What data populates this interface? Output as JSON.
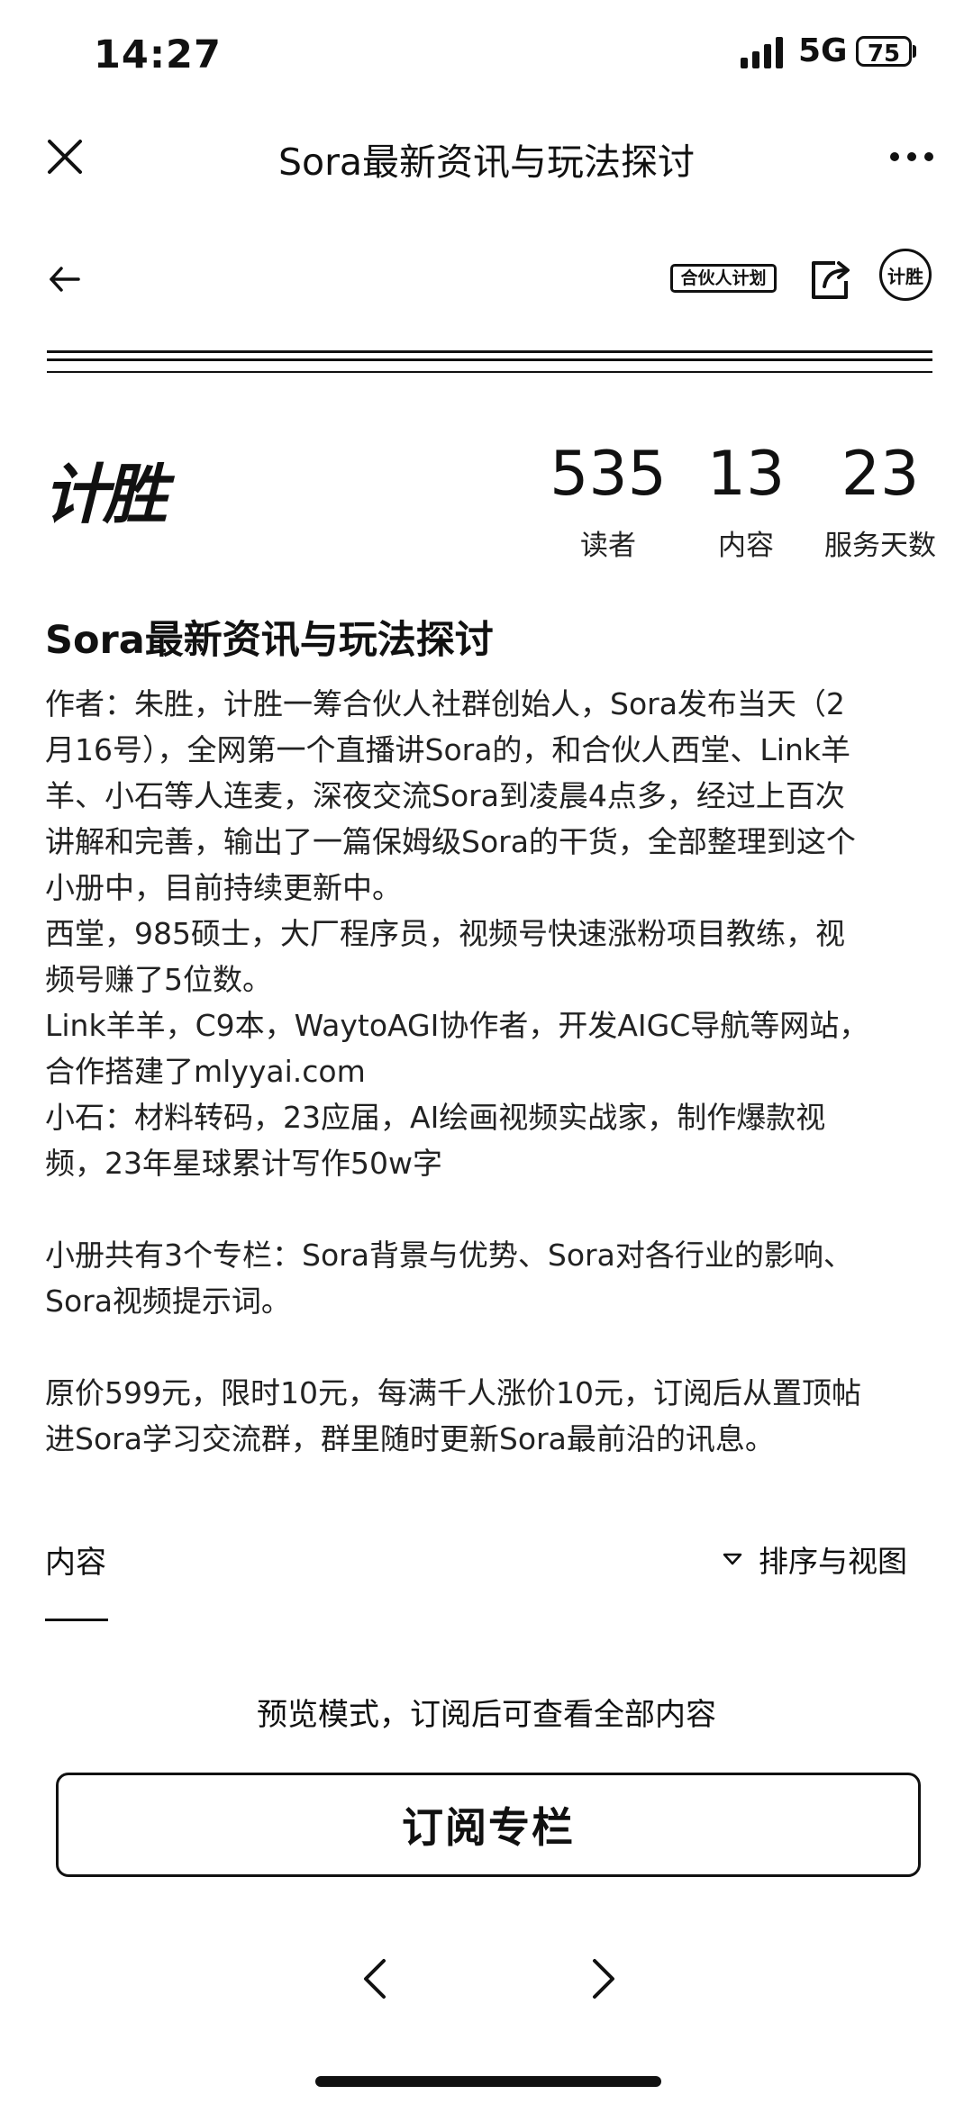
{
  "status_bar": {
    "time": "14:27",
    "network": "5G",
    "battery": "75"
  },
  "nav": {
    "title": "Sora最新资讯与玩法探讨",
    "close_icon": "close-icon",
    "more_icon": "more-icon"
  },
  "toolbar": {
    "back_icon": "back-arrow-icon",
    "partner_badge": "合伙人计划",
    "share_icon": "share-icon",
    "avatar_text": "计胜"
  },
  "profile": {
    "logo_text": "计胜",
    "stats": [
      {
        "value": "535",
        "label": "读者"
      },
      {
        "value": "13",
        "label": "内容"
      },
      {
        "value": "23",
        "label": "服务天数"
      }
    ]
  },
  "column": {
    "title": "Sora最新资讯与玩法探讨",
    "paragraphs": [
      "作者：朱胜，计胜一筹合伙人社群创始人，Sora发布当天（2\n月16号），全网第一个直播讲Sora的，和合伙人西堂、Link羊\n羊、小石等人连麦，深夜交流Sora到凌晨4点多，经过上百次\n讲解和完善，输出了一篇保姆级Sora的干货，全部整理到这个\n小册中，目前持续更新中。",
      "西堂，985硕士，大厂程序员，视频号快速涨粉项目教练，视\n频号赚了5位数。",
      "Link羊羊，C9本，WaytoAGI协作者，开发AIGC导航等网站，\n合作搭建了mlyyai.com",
      "小石：材料转码，23应届，AI绘画视频实战家，制作爆款视\n频，23年星球累计写作50w字",
      "小册共有3个专栏：Sora背景与优势、Sora对各行业的影响、\nSora视频提示词。",
      "原价599元，限时10元，每满千人涨价10元，订阅后从置顶帖\n进Sora学习交流群，群里随时更新Sora最前沿的讯息。"
    ]
  },
  "content_section": {
    "tab_label": "内容",
    "sort_label": "排序与视图",
    "preview_text": "预览模式，订阅后可查看全部内容",
    "subscribe_label": "订阅专栏"
  }
}
